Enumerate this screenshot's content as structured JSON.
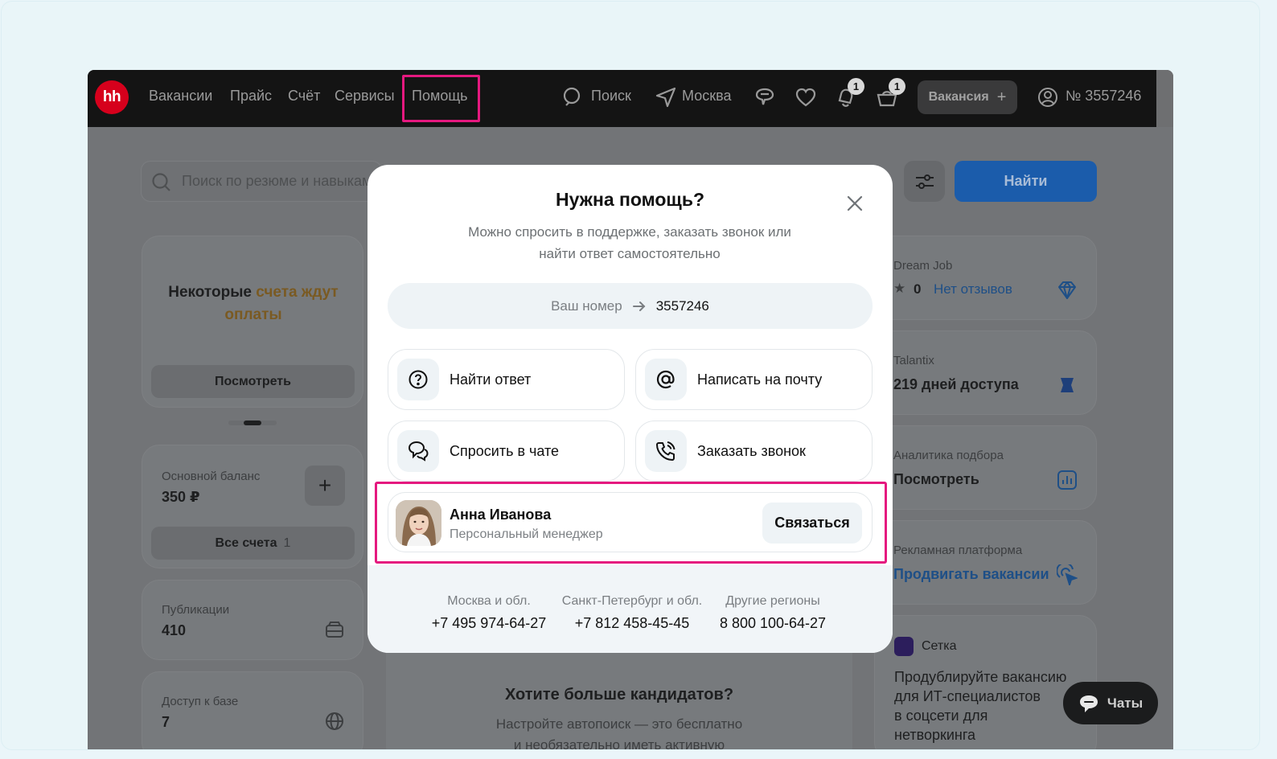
{
  "nav": {
    "logo": "hh",
    "items": [
      "Вакансии",
      "Прайс",
      "Счёт",
      "Сервисы",
      "Помощь"
    ],
    "search": "Поиск",
    "city": "Москва",
    "notif_badge": "1",
    "cart_badge": "1",
    "vacancy_button": "Вакансия",
    "vacancy_plus": "+",
    "account": "№ 3557246"
  },
  "background": {
    "search_placeholder": "Поиск по резюме и навыкам",
    "find_button": "Найти",
    "invoice_card": {
      "text_a": "Некоторые ",
      "text_b": "счета ждут оплаты",
      "button": "Посмотреть"
    },
    "balance": {
      "label": "Основной баланс",
      "value": "350 ₽",
      "plus": "+",
      "all_accounts": "Все счета",
      "count": "1"
    },
    "publications": {
      "label": "Публикации",
      "value": "410"
    },
    "db_access": {
      "label": "Доступ к базе",
      "value": "7"
    },
    "dreamjob": {
      "label": "Dream Job",
      "rating": "0",
      "reviews": "Нет отзывов"
    },
    "talantix": {
      "label": "Talantix",
      "value": "219 дней доступа"
    },
    "analytics": {
      "label": "Аналитика подбора",
      "value": "Посмотреть"
    },
    "ads": {
      "label": "Рекламная платформа",
      "value": "Продвигать вакансии"
    },
    "setka": {
      "label": "Сетка",
      "line1": "Продублируйте вакансию",
      "line2": "для ИТ-специалистов",
      "line3": "в соцсети для",
      "line4": "нетворкинга"
    },
    "promo": {
      "title": "Хотите больше кандидатов?",
      "line1": "Настройте автопоиск — это бесплатно",
      "line2": "и необязательно иметь активную"
    }
  },
  "modal": {
    "title": "Нужна помощь?",
    "subtitle_line1": "Можно спросить в поддержке, заказать звонок или",
    "subtitle_line2": "найти ответ самостоятельно",
    "number_label": "Ваш номер",
    "number_value": "3557246",
    "options": {
      "find_answer": "Найти ответ",
      "email": "Написать на почту",
      "chat": "Спросить в чате",
      "call": "Заказать звонок"
    },
    "manager": {
      "name": "Анна Иванова",
      "role": "Персональный менеджер",
      "contact_button": "Связаться"
    },
    "phones": [
      {
        "region": "Москва и обл.",
        "number": "+7 495 974-64-27"
      },
      {
        "region": "Санкт-Петербург и обл.",
        "number": "+7 812 458-45-45"
      },
      {
        "region": "Другие регионы",
        "number": "8 800 100-64-27"
      }
    ]
  },
  "chats_button": "Чаты",
  "colors": {
    "highlight": "#e5197f",
    "brand_red": "#d6001c",
    "find_blue": "#1b5cab",
    "accent_orange": "#c78a28",
    "link_blue": "#2f5fa6"
  }
}
